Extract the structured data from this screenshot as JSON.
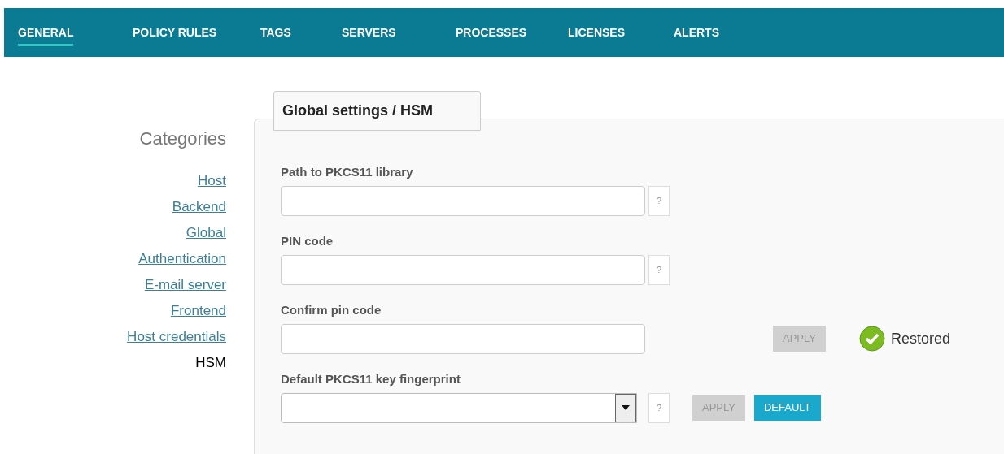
{
  "nav": {
    "tabs": [
      {
        "label": "GENERAL",
        "selected": true
      },
      {
        "label": "POLICY RULES",
        "selected": false
      },
      {
        "label": "TAGS",
        "selected": false
      },
      {
        "label": "SERVERS",
        "selected": false
      },
      {
        "label": "PROCESSES",
        "selected": false
      },
      {
        "label": "LICENSES",
        "selected": false
      },
      {
        "label": "ALERTS",
        "selected": false
      }
    ]
  },
  "sidebar": {
    "title": "Categories",
    "items": [
      {
        "label": "Host",
        "selected": false
      },
      {
        "label": "Backend",
        "selected": false
      },
      {
        "label": "Global",
        "selected": false
      },
      {
        "label": "Authentication",
        "selected": false
      },
      {
        "label": "E-mail server",
        "selected": false
      },
      {
        "label": "Frontend",
        "selected": false
      },
      {
        "label": "Host credentials",
        "selected": false
      },
      {
        "label": "HSM",
        "selected": true
      }
    ]
  },
  "panel": {
    "title": "Global settings / HSM",
    "fields": [
      {
        "label": "Path to PKCS11 library",
        "kind": "text",
        "help": "?"
      },
      {
        "label": "PIN code",
        "kind": "text",
        "help": "?"
      },
      {
        "label": "Confirm pin code",
        "kind": "text",
        "buttons": [
          {
            "label": "APPLY",
            "kind": "apply",
            "disabled": true
          }
        ],
        "status": {
          "text": "Restored",
          "kind": "ok"
        }
      },
      {
        "label": "Default PKCS11 key fingerprint",
        "kind": "select",
        "help": "?",
        "buttons": [
          {
            "label": "APPLY",
            "kind": "apply",
            "disabled": true
          },
          {
            "label": "DEFAULT",
            "kind": "default",
            "disabled": false
          }
        ]
      }
    ]
  }
}
